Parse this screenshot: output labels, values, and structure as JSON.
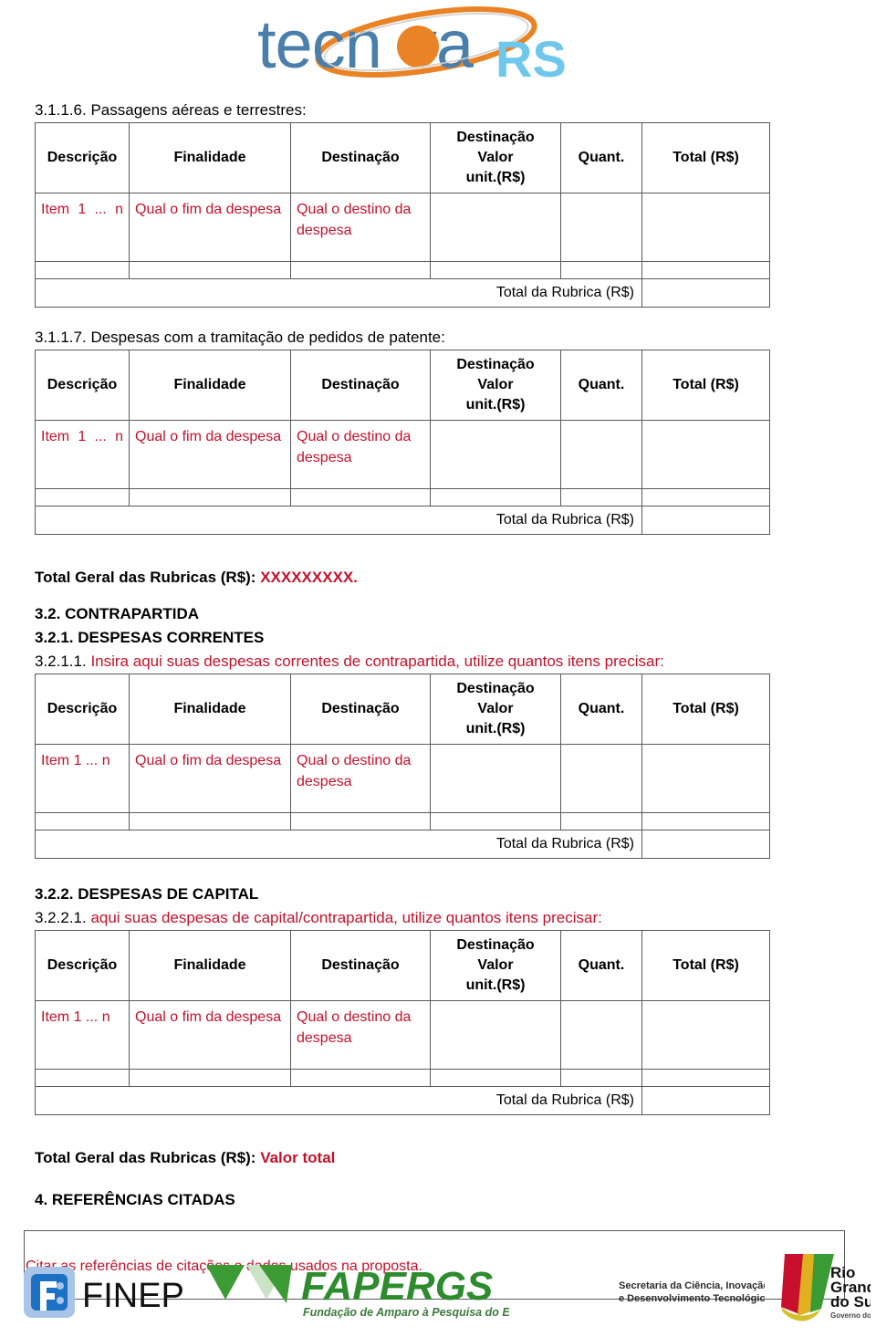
{
  "document": {
    "logo": {
      "name": "tecnova-rs-logo",
      "word_main": "tecnova",
      "word_suffix": "RS",
      "colors": {
        "blue": "#4A7FAC",
        "orange": "#E98325",
        "light_blue": "#6FC8EC"
      }
    },
    "colors": {
      "red": "#C3122B",
      "black": "#000000",
      "border": "#595959"
    },
    "table_headers": [
      "Descrição",
      "Finalidade",
      "Destinação",
      "Destinação Valor unit.(R$)",
      "Quant.",
      "Total (R$)"
    ],
    "table_header_lines": {
      "valor_line1": "Destinação",
      "valor_line2": "Valor",
      "valor_line3": "unit.(R$)"
    },
    "row_values": {
      "item_wrapped_1": "Item  1 ...",
      "item_wrapped_2": "n",
      "item_inline": "Item 1 ... n",
      "finalidade_1": "Qual o fim da",
      "finalidade_2": "despesa",
      "destinacao_1": "Qual o destino",
      "destinacao_2": "da despesa"
    },
    "rubrica_label": "Total da Rubrica (R$)",
    "sections": [
      {
        "id": "3.1.1.6",
        "number": "3.1.1.6.",
        "title": " Passagens aéreas e terrestres:",
        "bold": false,
        "red_title": false
      },
      {
        "id": "3.1.1.7",
        "number": "3.1.1.7.",
        "title": " Despesas com a tramitação de pedidos de patente:",
        "bold": false,
        "red_title": false
      }
    ],
    "total_geral_1": {
      "label": "Total Geral das Rubricas (R$): ",
      "value": "XXXXXXXXX."
    },
    "heading_3_2": "3.2. CONTRAPARTIDA",
    "heading_3_2_1": "3.2.1. DESPESAS CORRENTES",
    "heading_3_2_1_1": {
      "number": "3.2.1.1.",
      "text": " Insira aqui suas despesas correntes de contrapartida, utilize quantos itens precisar:"
    },
    "heading_3_2_2": "3.2.2. DESPESAS DE CAPITAL",
    "heading_3_2_2_1": {
      "number": "3.2.2.1.",
      "text": " aqui suas despesas de capital/contrapartida, utilize quantos itens precisar:"
    },
    "total_geral_2": {
      "label": "Total Geral das Rubricas (R$): ",
      "value": "Valor total"
    },
    "heading_4": "4. REFERÊNCIAS CITADAS",
    "reference_box_text": "Citar as referências de citações e dados usados na proposta.",
    "footer": {
      "finep": "FINEP",
      "fapergs": "FAPERGS",
      "fapergs_sub": "Fundação de Amparo à Pesquisa do Estado do Rio Grande do Sul",
      "secretaria_line1": "Secretaria da Ciência, Inovação",
      "secretaria_line2": "e Desenvolvimento Tecnológico",
      "rs_line1": "Rio",
      "rs_line2": "Grande",
      "rs_line3": "do Sul",
      "rs_line4": "Governo do Estado"
    }
  }
}
